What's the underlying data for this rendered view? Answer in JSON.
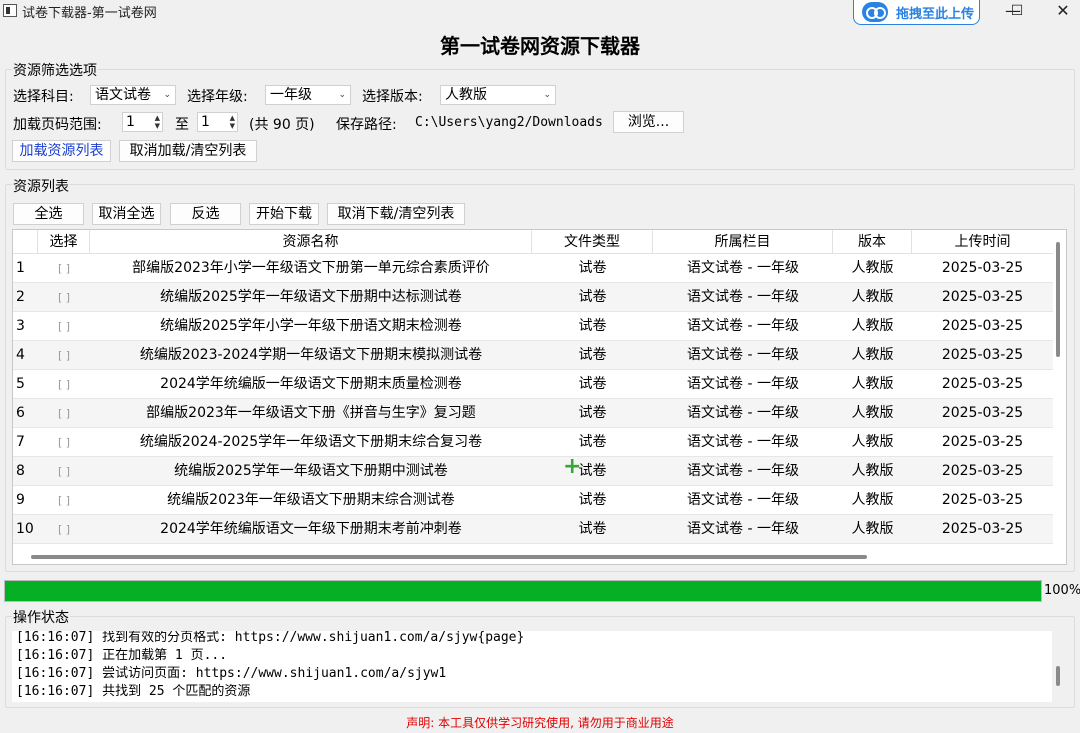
{
  "window": {
    "title": "试卷下载器-第一试卷网",
    "upload_label": "拖拽至此上传",
    "minimize": "—",
    "maximize": "☐",
    "close": "✕",
    "accent": "#2a82e4"
  },
  "app_title": "第一试卷网资源下载器",
  "filter": {
    "group_title": "资源筛选选项",
    "subject_label": "选择科目:",
    "subject_value": "语文试卷",
    "grade_label": "选择年级:",
    "grade_value": "一年级",
    "edition_label": "选择版本:",
    "edition_value": "人教版",
    "range_label": "加载页码范围:",
    "range_from": "1",
    "range_to_label": "至",
    "range_to": "1",
    "total_pages": "(共 90 页)",
    "save_label": "保存路径:",
    "save_path": "C:\\Users\\yang2/Downloads",
    "browse_btn": "浏览...",
    "load_btn": "加载资源列表",
    "cancel_btn": "取消加载/清空列表"
  },
  "list": {
    "group_title": "资源列表",
    "select_all": "全选",
    "deselect_all": "取消全选",
    "invert": "反选",
    "start_download": "开始下载",
    "cancel_download": "取消下载/清空列表",
    "headers": [
      "",
      "选择",
      "资源名称",
      "文件类型",
      "所属栏目",
      "版本",
      "上传时间"
    ],
    "rows": [
      {
        "num": "1",
        "check": "[ ]",
        "name": "部编版2023年小学一年级语文下册第一单元综合素质评价",
        "type": "试卷",
        "column": "语文试卷 - 一年级",
        "edition": "人教版",
        "date": "2025-03-25"
      },
      {
        "num": "2",
        "check": "[ ]",
        "name": "统编版2025学年一年级语文下册期中达标测试卷",
        "type": "试卷",
        "column": "语文试卷 - 一年级",
        "edition": "人教版",
        "date": "2025-03-25"
      },
      {
        "num": "3",
        "check": "[ ]",
        "name": "统编版2025学年小学一年级下册语文期末检测卷",
        "type": "试卷",
        "column": "语文试卷 - 一年级",
        "edition": "人教版",
        "date": "2025-03-25"
      },
      {
        "num": "4",
        "check": "[ ]",
        "name": "统编版2023-2024学期一年级语文下册期末模拟测试卷",
        "type": "试卷",
        "column": "语文试卷 - 一年级",
        "edition": "人教版",
        "date": "2025-03-25"
      },
      {
        "num": "5",
        "check": "[ ]",
        "name": "2024学年统编版一年级语文下册期末质量检测卷",
        "type": "试卷",
        "column": "语文试卷 - 一年级",
        "edition": "人教版",
        "date": "2025-03-25"
      },
      {
        "num": "6",
        "check": "[ ]",
        "name": "部编版2023年一年级语文下册《拼音与生字》复习题",
        "type": "试卷",
        "column": "语文试卷 - 一年级",
        "edition": "人教版",
        "date": "2025-03-25"
      },
      {
        "num": "7",
        "check": "[ ]",
        "name": "统编版2024-2025学年一年级语文下册期末综合复习卷",
        "type": "试卷",
        "column": "语文试卷 - 一年级",
        "edition": "人教版",
        "date": "2025-03-25"
      },
      {
        "num": "8",
        "check": "[ ]",
        "name": "统编版2025学年一年级语文下册期中测试卷",
        "type": "试卷",
        "column": "语文试卷 - 一年级",
        "edition": "人教版",
        "date": "2025-03-25"
      },
      {
        "num": "9",
        "check": "[ ]",
        "name": "统编版2023年一年级语文下册期末综合测试卷",
        "type": "试卷",
        "column": "语文试卷 - 一年级",
        "edition": "人教版",
        "date": "2025-03-25"
      },
      {
        "num": "10",
        "check": "[ ]",
        "name": "2024学年统编版语文一年级下册期末考前冲刺卷",
        "type": "试卷",
        "column": "语文试卷 - 一年级",
        "edition": "人教版",
        "date": "2025-03-25"
      }
    ]
  },
  "progress": {
    "value": 1.0,
    "label": "100%",
    "color": "#06b025"
  },
  "status": {
    "group_title": "操作状态",
    "log": [
      "[16:16:07] 找到有效的分页格式: https://www.shijuan1.com/a/sjyw{page}",
      "[16:16:07] 正在加载第 1 页...",
      "[16:16:07] 尝试访问页面: https://www.shijuan1.com/a/sjyw1",
      "[16:16:07] 共找到 25 个匹配的资源"
    ]
  },
  "disclaimer": "声明: 本工具仅供学习研究使用, 请勿用于商业用途",
  "disclaimer_color": "#e00000"
}
